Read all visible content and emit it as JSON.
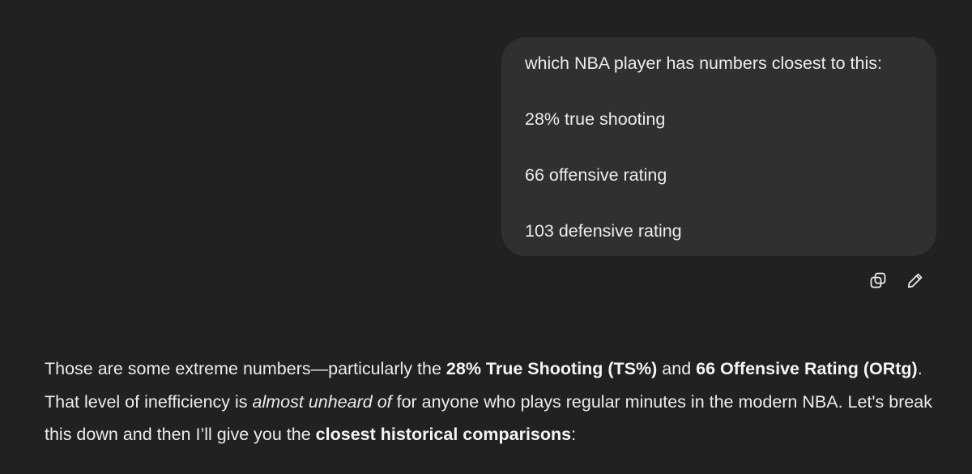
{
  "user_message": {
    "lines": [
      "which NBA player has numbers closest to this:",
      "28% true shooting",
      "66 offensive rating",
      "103 defensive rating"
    ]
  },
  "message_actions": {
    "icons": [
      "copy-icon",
      "edit-pencil-icon"
    ]
  },
  "assistant_message": {
    "segments": [
      {
        "text": "Those are some extreme numbers—particularly the ",
        "style": "normal"
      },
      {
        "text": "28% True Shooting (TS%)",
        "style": "bold"
      },
      {
        "text": " and ",
        "style": "normal"
      },
      {
        "text": "66 Offensive Rating (ORtg)",
        "style": "bold"
      },
      {
        "text": ". That level of inefficiency is ",
        "style": "normal"
      },
      {
        "text": "almost unheard of",
        "style": "italic"
      },
      {
        "text": " for anyone who plays regular minutes in the modern NBA. Let's break this down and then I’ll give you the ",
        "style": "normal"
      },
      {
        "text": "closest historical comparisons",
        "style": "bold"
      },
      {
        "text": ":",
        "style": "normal"
      }
    ]
  }
}
